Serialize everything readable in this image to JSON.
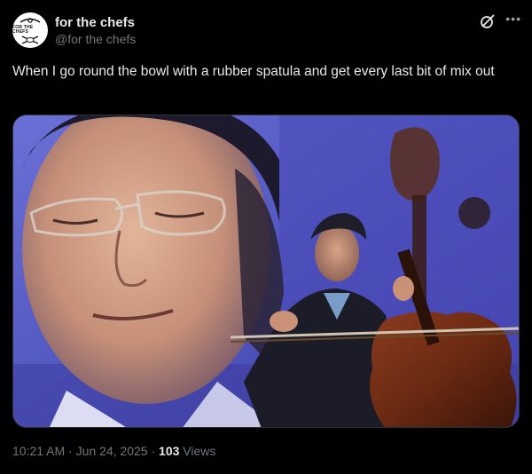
{
  "author": {
    "display_name": "for the chefs",
    "handle": "@for the chefs",
    "avatar_text": "FOR THE CHEFS"
  },
  "tweet": {
    "text": "When I go round the bowl with a rubber spatula and get every last bit of mix out"
  },
  "media": {
    "description_icon": "photo-of-cellist"
  },
  "meta": {
    "time": "10:21 AM",
    "separator": "·",
    "date": "Jun 24, 2025",
    "views_count": "103",
    "views_label": "Views"
  },
  "icons": {
    "grok": "grok-icon",
    "more": "more-icon"
  },
  "colors": {
    "background": "#000000",
    "text_primary": "#e7e9ea",
    "text_secondary": "#71767b",
    "media_backdrop": "#5a5fc4"
  }
}
